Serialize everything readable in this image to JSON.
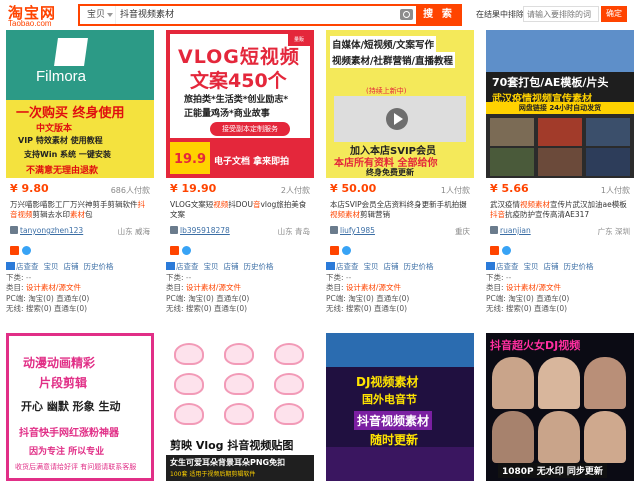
{
  "header": {
    "logo_main": "淘宝网",
    "logo_sub": "Taobao.com",
    "search_scope": "宝贝",
    "search_query": "抖音视频素材",
    "search_button": "搜 索",
    "filter_label": "在结果中排除",
    "filter_placeholder": "请输入要排除的词",
    "filter_button": "确定"
  },
  "products": [
    {
      "price": "¥ 9.80",
      "deal": "686人付款",
      "title_pre": "万兴喵影喵影工厂万兴神剪手剪辑软件",
      "title_hl": "抖音视频",
      "title_post": "剪辑去水印",
      "title_hl2": "素材",
      "title_end": "包",
      "shop": "tanyongzhen123",
      "location": "山东 威海",
      "thumb": {
        "logo": "Filmora",
        "l1": "一次购买 终身使用",
        "l2": "中文版本",
        "l3": "VIP 特效素材 使用教程",
        "l4": "支持Win 系统 一键安装",
        "l5": "不满意无理由退款"
      }
    },
    {
      "price": "¥ 19.90",
      "deal": "2人付款",
      "title_pre": "VLOG文案短",
      "title_hl": "视频",
      "title_post": "抖DOU",
      "title_hl2": "音",
      "title_end": "vlog旅拍美食文案",
      "title2_pre": "",
      "shop": "lb395918278",
      "location": "山东 青岛",
      "thumb": {
        "h1": "VLOG短视频",
        "h2": "文案450个",
        "h3": "旅拍类*生活类*创业励志*",
        "h4": "正能量鸡汤*商业故事",
        "pill": "接受副本定制服务",
        "price": "19.9",
        "bottom": "电子文档 拿来即拍",
        "corner": "量贩"
      }
    },
    {
      "price": "¥ 50.00",
      "deal": "1人付款",
      "title_pre": "本店SVIP会员全店资料终身更新手机拍摄",
      "title_hl": "视频素材",
      "title_post": "剪辑营销",
      "title_hl2": "",
      "title_end": "",
      "shop": "liufy1985",
      "location": "重庆",
      "thumb": {
        "l1": "自媒体/短视频/文案写作",
        "l2": "视频素材/社群营销/直播教程",
        "l3": "店铺营销/软件工具/课程",
        "tag": "(持续上新中)",
        "c1": "加入本店SVIP会员",
        "c2": "本店所有资料 全部给你",
        "c3": "终身免费更新"
      }
    },
    {
      "price": "¥ 5.66",
      "deal": "1人付款",
      "title_pre": "武汉疫情",
      "title_hl": "视频素材",
      "title_post": "宣传片武汉加油ae模板",
      "title_hl2": "抖音",
      "title_end": "抗疫防护宣传高清AE317",
      "shop": "ruanjian",
      "location": "广东 深圳",
      "thumb": {
        "m1": "70套打包/AE模板/片头",
        "m2": "武汉疫情视频宣传素材",
        "bar": "网盘链接 24小时自动发货"
      }
    }
  ],
  "meta": {
    "link1": "店查查",
    "link2": "宝贝",
    "link3": "店铺",
    "link4": "历史价格",
    "row_type_label": "下类:",
    "row_type_value": "--",
    "row_cat_label": "类目:",
    "row_cat_value": "设计素材/源文件",
    "row_pc_label": "PC端:",
    "row_pc_value1": "淘宝(0)",
    "row_pc_value2": "直通车(0)",
    "row_mobile_label": "无线:",
    "row_mobile_value1": "搜索(0)",
    "row_mobile_value2": "直通车(0)"
  },
  "row2": [
    {
      "t1": "动漫动画精彩",
      "t2": "片段剪辑",
      "t3": "开心 幽默 形象 生动",
      "t4": "抖音快手网红涨粉神器",
      "t5": "因为专注 所以专业",
      "t6": "收货后满意请给好评 有问题请联系客服"
    },
    {
      "t1": "剪映 Vlog 抖音视频贴图",
      "t2": "女生可爱耳朵背景耳朵PNG免扣",
      "t3": "100套 适用于视频后期剪辑软件"
    },
    {
      "s1": "DJ视频素材",
      "s2": "国外电音节",
      "s3": "抖音视频素材",
      "s4": "随时更新"
    },
    {
      "k1": "抖音超火女DJ视频",
      "k2": "1080P 无水印 同步更新"
    }
  ]
}
